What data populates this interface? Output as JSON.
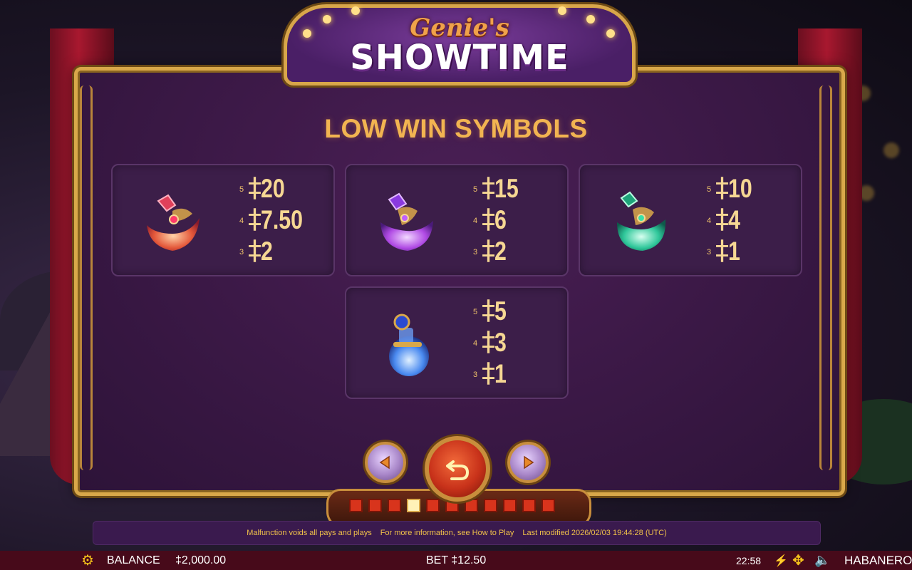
{
  "game": {
    "logo_top": "Genie's",
    "logo_main": "SHOWTIME"
  },
  "paytable": {
    "heading": "LOW WIN SYMBOLS",
    "currency": "‡",
    "symbols": [
      {
        "name": "red-gem-pouch",
        "pays": [
          {
            "count": "5",
            "value": "20"
          },
          {
            "count": "4",
            "value": "7.50"
          },
          {
            "count": "3",
            "value": "2"
          }
        ]
      },
      {
        "name": "purple-gem-pouch",
        "pays": [
          {
            "count": "5",
            "value": "15"
          },
          {
            "count": "4",
            "value": "6"
          },
          {
            "count": "3",
            "value": "2"
          }
        ]
      },
      {
        "name": "green-gem-pouch",
        "pays": [
          {
            "count": "5",
            "value": "10"
          },
          {
            "count": "4",
            "value": "4"
          },
          {
            "count": "3",
            "value": "1"
          }
        ]
      },
      {
        "name": "blue-potion-bottle",
        "pays": [
          {
            "count": "5",
            "value": "5"
          },
          {
            "count": "4",
            "value": "3"
          },
          {
            "count": "3",
            "value": "1"
          }
        ]
      }
    ]
  },
  "navigation": {
    "prev_icon": "triangle-left-icon",
    "back_icon": "return-arrow-icon",
    "next_icon": "triangle-right-icon",
    "pages": 11,
    "current_page": 4
  },
  "info": {
    "malfunction": "Malfunction voids all pays and plays",
    "more_info": "For more information, see How to Play",
    "last_modified": "Last modified 2026/02/03 19:44:28 (UTC)"
  },
  "status": {
    "settings_icon": "gear-icon",
    "balance_label": "BALANCE",
    "balance_value": "‡2,000.00",
    "bet_label": "BET ‡12.50",
    "clock": "22:58",
    "turbo_icon": "lightning-icon",
    "fullscreen_icon": "fullscreen-arrows-icon",
    "sound_icon": "speaker-icon",
    "brand": "HABANERO"
  },
  "colors": {
    "gold": "#f2b451",
    "panel": "#3c1e49",
    "status_bg": "#470a1a",
    "info_text": "#f0c14a"
  }
}
